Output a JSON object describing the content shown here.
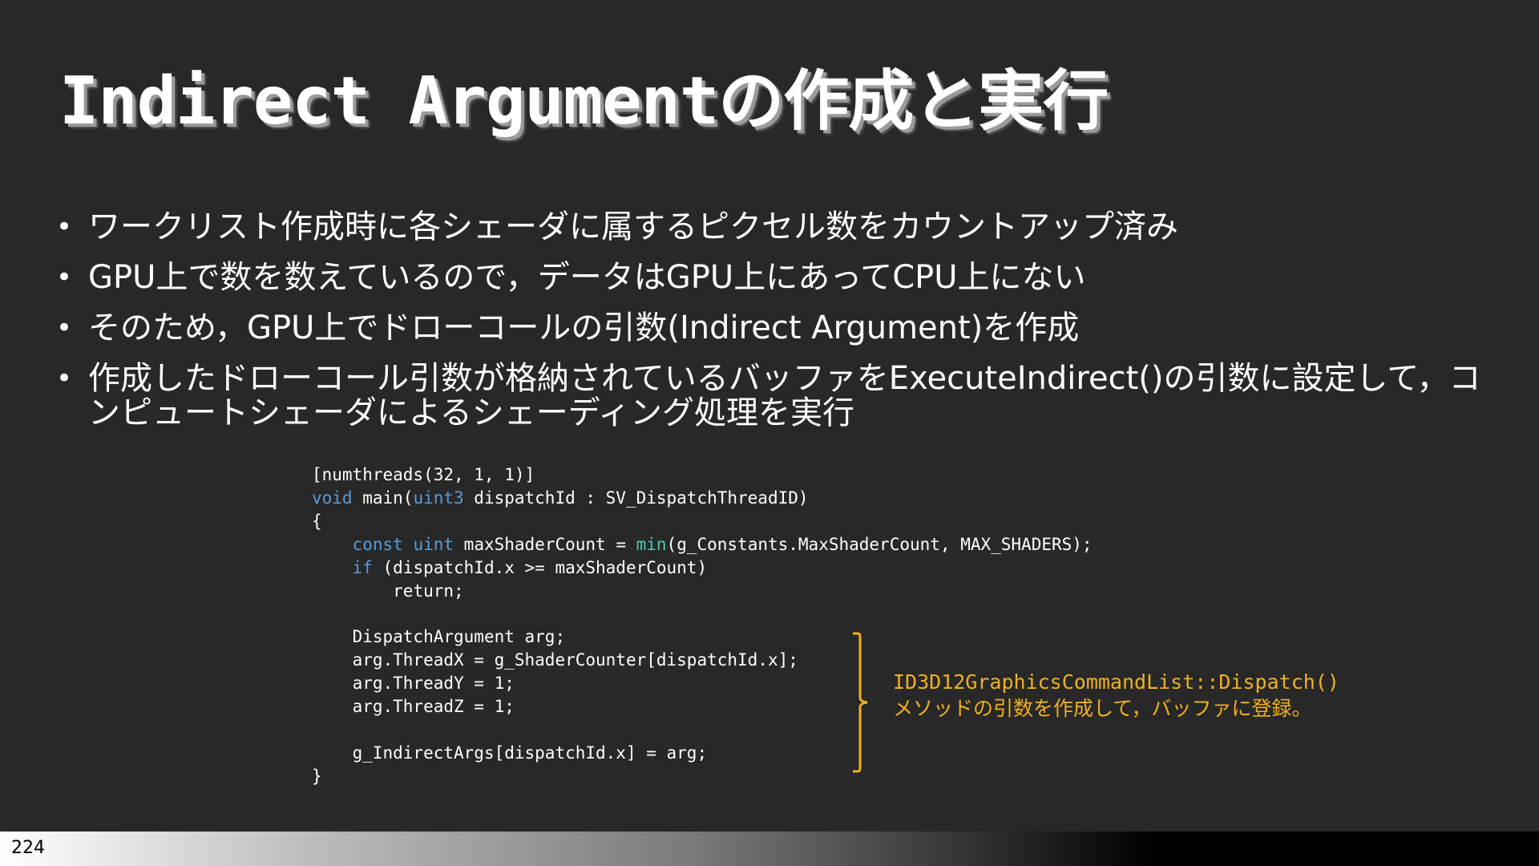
{
  "title": "Indirect Argumentの作成と実行",
  "bullets": [
    "ワークリスト作成時に各シェーダに属するピクセル数をカウントアップ済み",
    "GPU上で数を数えているので，データはGPU上にあってCPU上にない",
    "そのため，GPU上でドローコールの引数(Indirect Argument)を作成",
    "作成したドローコール引数が格納されているバッファをExecuteIndirect()の引数に設定して，コンピュートシェーダによるシェーディング処理を実行"
  ],
  "code": {
    "line1": "[numthreads(32, 1, 1)]",
    "kw_void": "void",
    "line2_a": " main(",
    "kw_uint3": "uint3",
    "line2_b": " dispatchId : SV_DispatchThreadID)",
    "line3": "{",
    "kw_const": "const",
    "kw_uint": "uint",
    "line4_a": " maxShaderCount = ",
    "fn_min": "min",
    "line4_b": "(g_Constants.MaxShaderCount, MAX_SHADERS);",
    "kw_if": "if",
    "line5": " (dispatchId.x >= maxShaderCount)",
    "line6": "return;",
    "line8": "DispatchArgument arg;",
    "line9": "arg.ThreadX = g_ShaderCounter[dispatchId.x];",
    "line10": "arg.ThreadY = 1;",
    "line11": "arg.ThreadZ = 1;",
    "line13": "g_IndirectArgs[dispatchId.x] = arg;",
    "line14": "}"
  },
  "annotation": {
    "line1": "ID3D12GraphicsCommandList::Dispatch()",
    "line2": "メソッドの引数を作成して，バッファに登録。"
  },
  "footer": {
    "page_number": "224"
  },
  "colors": {
    "background": "#282828",
    "keyword": "#569cd6",
    "function": "#4ec9b0",
    "annotation": "#f0b020"
  }
}
